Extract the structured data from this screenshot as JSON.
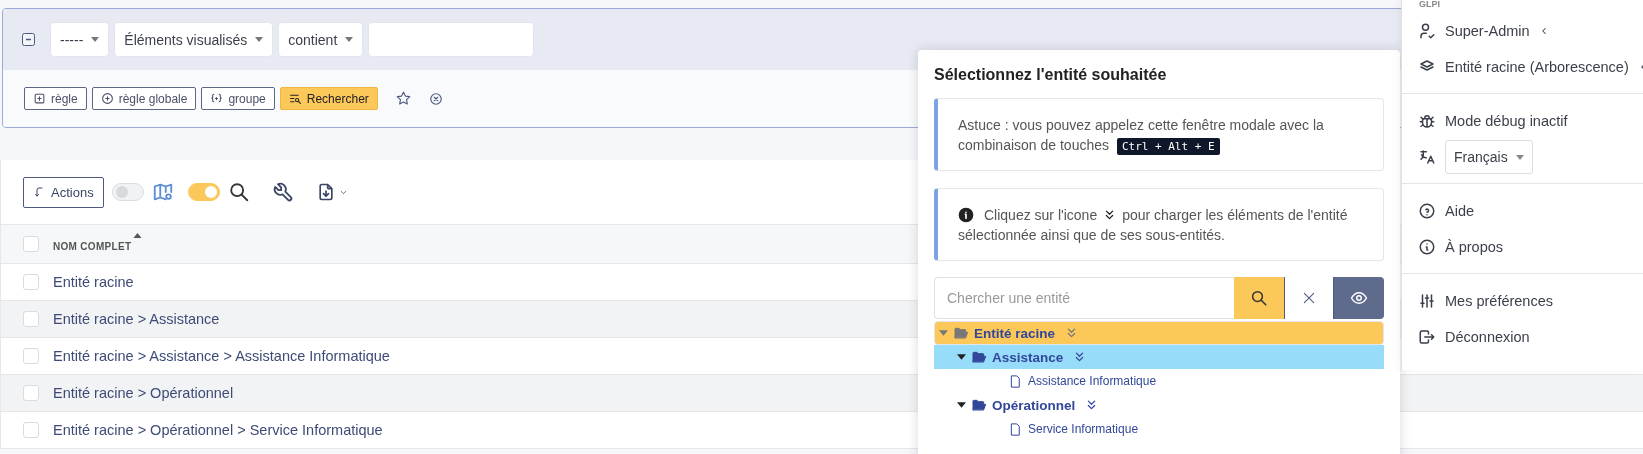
{
  "filter": {
    "expanded": true,
    "selects": [
      {
        "value": "-----"
      },
      {
        "value": "Éléments visualisés"
      },
      {
        "value": "contient"
      }
    ],
    "buttons": [
      {
        "label": "règle",
        "kind": "outline"
      },
      {
        "label": "règle globale",
        "kind": "outline"
      },
      {
        "label": "groupe",
        "kind": "outline"
      },
      {
        "label": "Rechercher",
        "kind": "primary"
      }
    ]
  },
  "toolbar": {
    "actions_label": "Actions",
    "map_toggle": {
      "on": false
    },
    "search_toggle": {
      "on": true
    }
  },
  "table": {
    "header_checked": false,
    "columns": [
      {
        "label": "NOM COMPLET",
        "sorted": true
      }
    ],
    "rows": [
      {
        "name": "Entité racine",
        "checked": false
      },
      {
        "name": "Entité racine > Assistance",
        "checked": false
      },
      {
        "name": "Entité racine > Assistance > Assistance Informatique",
        "checked": false
      },
      {
        "name": "Entité racine > Opérationnel",
        "checked": false
      },
      {
        "name": "Entité racine > Opérationnel > Service Informatique",
        "checked": false
      }
    ]
  },
  "modal": {
    "title": "Sélectionnez l'entité souhaitée",
    "tip": {
      "text": "Astuce : vous pouvez appelez cette fenêtre modale avec la combinaison de touches",
      "shortcut": "Ctrl + Alt + E"
    },
    "info": {
      "before": "Cliquez sur l'icone",
      "after": "pour charger les éléments de l'entité",
      "continuation": "sélectionnée ainsi que de ses sous-entités."
    },
    "search": {
      "placeholder": "Chercher une entité"
    },
    "tree": [
      {
        "label": "Entité racine",
        "kind": "folder",
        "expanded": true,
        "selected": true,
        "hovered": false,
        "children": [
          {
            "label": "Assistance",
            "kind": "folder",
            "expanded": true,
            "selected": false,
            "hovered": true,
            "children": [
              {
                "label": "Assistance Informatique",
                "kind": "leaf",
                "selected": false,
                "hovered": false
              }
            ]
          },
          {
            "label": "Opérationnel",
            "kind": "folder",
            "expanded": true,
            "selected": false,
            "hovered": false,
            "children": [
              {
                "label": "Service Informatique",
                "kind": "leaf",
                "selected": false,
                "hovered": false
              }
            ]
          }
        ]
      }
    ]
  },
  "user_menu": {
    "header": "GLPI",
    "sections": [
      [
        {
          "label": "Super-Admin",
          "kind": "submenu"
        },
        {
          "label": "Entité racine (Arborescence)",
          "kind": "submenu"
        }
      ],
      [
        {
          "label": "Mode débug inactif",
          "kind": "link"
        },
        {
          "label": "Français",
          "kind": "select"
        }
      ],
      [
        {
          "label": "Aide",
          "kind": "link"
        },
        {
          "label": "À propos",
          "kind": "link"
        }
      ],
      [
        {
          "label": "Mes préférences",
          "kind": "link"
        },
        {
          "label": "Déconnexion",
          "kind": "link"
        }
      ]
    ]
  }
}
